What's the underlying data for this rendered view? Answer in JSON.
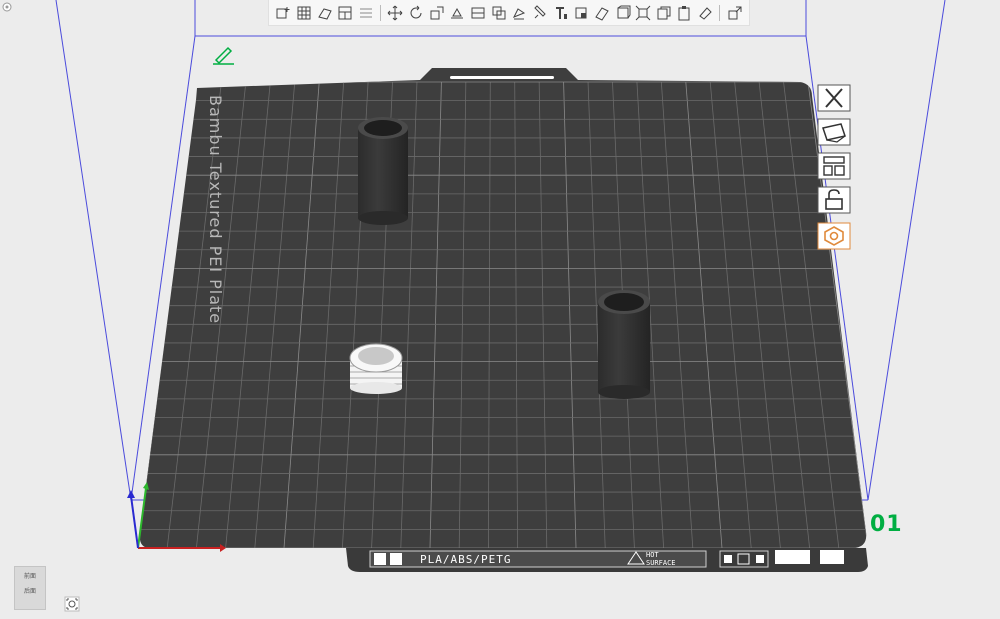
{
  "viewport": {
    "plate_name": "Bambu Textured PEI Plate",
    "plate_number": "01",
    "filament_label": "PLA/ABS/PETG",
    "warning_label_line1": "HOT",
    "warning_label_line2": "SURFACE"
  },
  "toolbar": {
    "items": [
      "add-object-icon",
      "arrange-grid-icon",
      "orient-icon",
      "split-plate-icon",
      "layers-icon",
      "move-icon",
      "rotate-icon",
      "scale-icon",
      "place-on-face-icon",
      "cut-icon",
      "boolean-icon",
      "support-paint-icon",
      "seam-paint-icon",
      "text-icon",
      "color-paint-icon",
      "measure-icon",
      "assembly-icon",
      "explode-icon",
      "copy-icon",
      "paste-icon",
      "eraser-icon",
      "view-settings-icon"
    ]
  },
  "side_panel": {
    "items": [
      "close-plate-icon",
      "auto-orient-plate-icon",
      "arrange-plate-icon",
      "lock-plate-icon",
      "plate-settings-icon"
    ]
  },
  "nav_cube": {
    "front_label": "前面",
    "bottom_label": "后面"
  },
  "colors": {
    "accent": "#00ae42",
    "bed": "#3e3e3e",
    "volume_lines": "#4b4bdc"
  }
}
